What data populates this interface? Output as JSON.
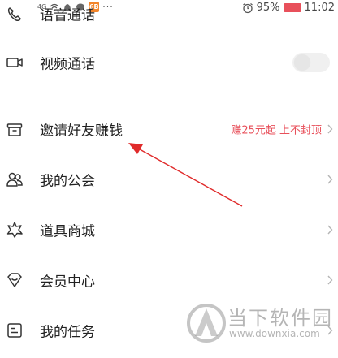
{
  "status_bar": {
    "network": "4G",
    "alarm_icon": "alarm-icon",
    "battery": "95%",
    "time": "11:02",
    "app_icon_text": "6B",
    "dots": "···"
  },
  "menu": {
    "items": [
      {
        "name": "voice-call",
        "icon": "phone-icon",
        "label": "语音通话"
      },
      {
        "name": "video-call",
        "icon": "video-icon",
        "label": "视频通话",
        "toggle_on": false
      },
      {
        "name": "invite-friends",
        "icon": "gift-box-icon",
        "label": "邀请好友赚钱",
        "promo": "赚25元起 上不封顶"
      },
      {
        "name": "my-guild",
        "icon": "people-icon",
        "label": "我的公会"
      },
      {
        "name": "props-mall",
        "icon": "star-burst-icon",
        "label": "道具商城"
      },
      {
        "name": "member-center",
        "icon": "heart-shield-icon",
        "label": "会员中心"
      },
      {
        "name": "my-tasks",
        "icon": "task-card-icon",
        "label": "我的任务"
      }
    ]
  },
  "watermark": {
    "name": "当下软件园",
    "url": "www.downxia.com"
  },
  "colors": {
    "accent": "#e8505b",
    "annotation_arrow": "#e02b2b"
  }
}
